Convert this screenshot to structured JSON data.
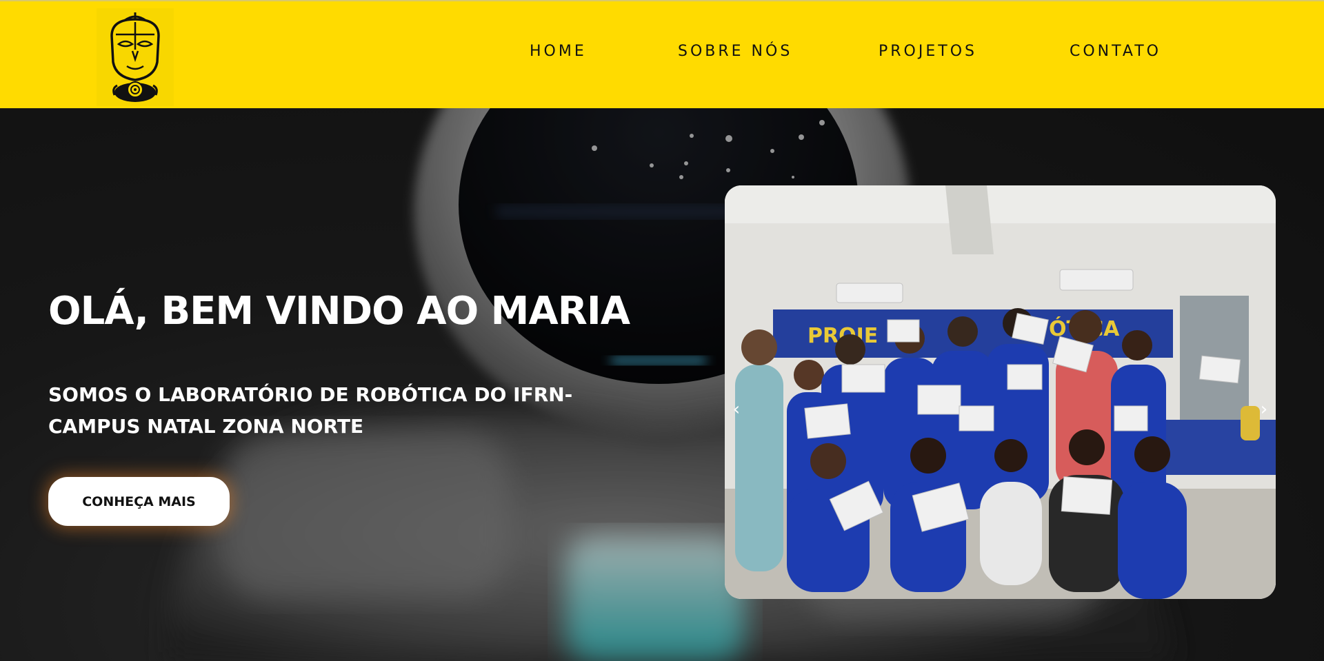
{
  "nav": {
    "home": "HOME",
    "about": "SOBRE NÓS",
    "projects": "PROJETOS",
    "contact": "CONTATO"
  },
  "hero": {
    "title": "OLÁ, BEM VINDO AO MARIA",
    "subtitle": "SOMOS O LABORATÓRIO DE ROBÓTICA DO IFRN-CAMPUS NATAL ZONA NORTE",
    "cta_label": "CONHEÇA MAIS"
  },
  "carousel": {
    "prev_icon": "chevron-left-icon",
    "next_icon": "chevron-right-icon",
    "prev_glyph": "‹",
    "next_glyph": "›"
  },
  "colors": {
    "header_bg": "#FFDB00",
    "hero_bg": "#1c1c1c",
    "text_light": "#ffffff",
    "cta_bg": "#ffffff",
    "cta_glow": "#ff8c28"
  }
}
